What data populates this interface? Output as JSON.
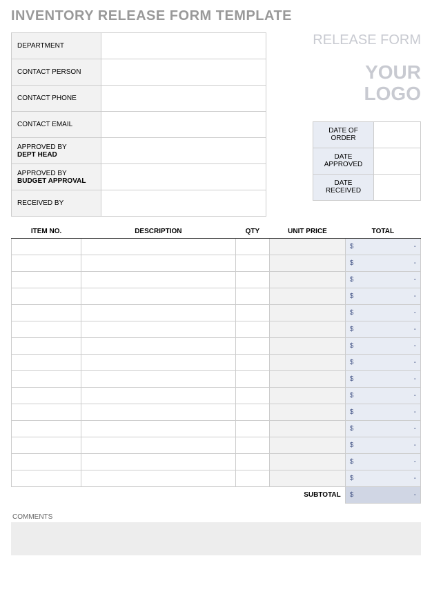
{
  "title": "INVENTORY RELEASE FORM TEMPLATE",
  "release_label": "RELEASE FORM",
  "logo_line1": "YOUR",
  "logo_line2": "LOGO",
  "info": {
    "department_label": "DEPARTMENT",
    "department_value": "",
    "contact_person_label": "CONTACT PERSON",
    "contact_person_value": "",
    "contact_phone_label": "CONTACT PHONE",
    "contact_phone_value": "",
    "contact_email_label": "CONTACT EMAIL",
    "contact_email_value": "",
    "approved_by_label": "APPROVED BY",
    "dept_head_label": "DEPT HEAD",
    "approved_by_dept_value": "",
    "budget_approval_label": "BUDGET APPROVAL",
    "approved_by_budget_value": "",
    "received_by_label": "RECEIVED BY",
    "received_by_value": ""
  },
  "dates": {
    "order_label": "DATE OF ORDER",
    "order_value": "",
    "approved_label": "DATE APPROVED",
    "approved_value": "",
    "received_label": "DATE RECEIVED",
    "received_value": ""
  },
  "items_header": {
    "item_no": "ITEM NO.",
    "description": "DESCRIPTION",
    "qty": "QTY",
    "unit_price": "UNIT PRICE",
    "total": "TOTAL"
  },
  "currency_symbol": "$",
  "dash": "-",
  "subtotal_label": "SUBTOTAL",
  "comments_label": "COMMENTS",
  "comments_value": ""
}
